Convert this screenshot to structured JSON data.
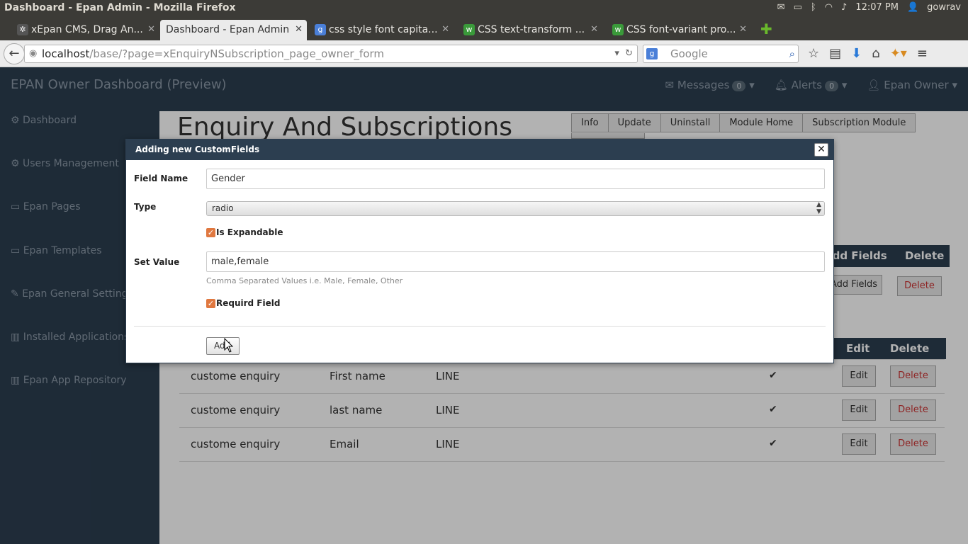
{
  "os": {
    "window_title": "Dashboard - Epan Admin - Mozilla Firefox",
    "clock": "12:07 PM",
    "user": "gowrav"
  },
  "browser": {
    "tabs": [
      {
        "label": "xEpan CMS, Drag An..."
      },
      {
        "label": "Dashboard - Epan Admin"
      },
      {
        "label": "css style font capita..."
      },
      {
        "label": "CSS text-transform ..."
      },
      {
        "label": "CSS font-variant pro..."
      }
    ],
    "url_host": "localhost",
    "url_path": "/base/?page=xEnquiryNSubscription_page_owner_form",
    "search_placeholder": "Google"
  },
  "app": {
    "brand": "EPAN Owner Dashboard (Preview)",
    "messages_label": "Messages",
    "messages_count": "0",
    "alerts_label": "Alerts",
    "alerts_count": "0",
    "user_label": "Epan Owner"
  },
  "sidebar": {
    "items": [
      {
        "label": "Dashboard"
      },
      {
        "label": "Users Management"
      },
      {
        "label": "Epan Pages"
      },
      {
        "label": "Epan Templates"
      },
      {
        "label": "Epan General Settings"
      },
      {
        "label": "Installed Applications"
      },
      {
        "label": "Epan App Repository"
      }
    ]
  },
  "main": {
    "title": "Enquiry And Subscriptions",
    "module_buttons": [
      "Info",
      "Update",
      "Uninstall",
      "Module Home",
      "Subscription Module"
    ],
    "forms_header": {
      "add_fields": "Add Fields",
      "delete": "Delete"
    },
    "forms_row": {
      "add_fields": "Add Fields",
      "delete": "Delete"
    },
    "fields_header": {
      "edit": "Edit",
      "delete": "Delete"
    },
    "rows": [
      {
        "form": "custome enquiry",
        "name": "First name",
        "type": "LINE",
        "check": "✔",
        "edit": "Edit",
        "delete": "Delete"
      },
      {
        "form": "custome enquiry",
        "name": "last name",
        "type": "LINE",
        "check": "✔",
        "edit": "Edit",
        "delete": "Delete"
      },
      {
        "form": "custome enquiry",
        "name": "Email",
        "type": "LINE",
        "check": "✔",
        "edit": "Edit",
        "delete": "Delete"
      }
    ]
  },
  "dialog": {
    "title": "Adding new CustomFields",
    "close": "✕",
    "field_name_label": "Field Name",
    "field_name_value": "Gender",
    "type_label": "Type",
    "type_value": "radio",
    "expandable_label": "Is Expandable",
    "expandable_checked": true,
    "set_value_label": "Set Value",
    "set_value_value": "male,female",
    "set_value_hint": "Comma Separated Values i.e. Male, Female, Other",
    "required_label": "Requird Field",
    "required_checked": true,
    "add_button": "Add"
  },
  "colors": {
    "navy": "#2c3e50",
    "delete_red": "#cc3333",
    "checkbox_orange": "#e07840"
  }
}
